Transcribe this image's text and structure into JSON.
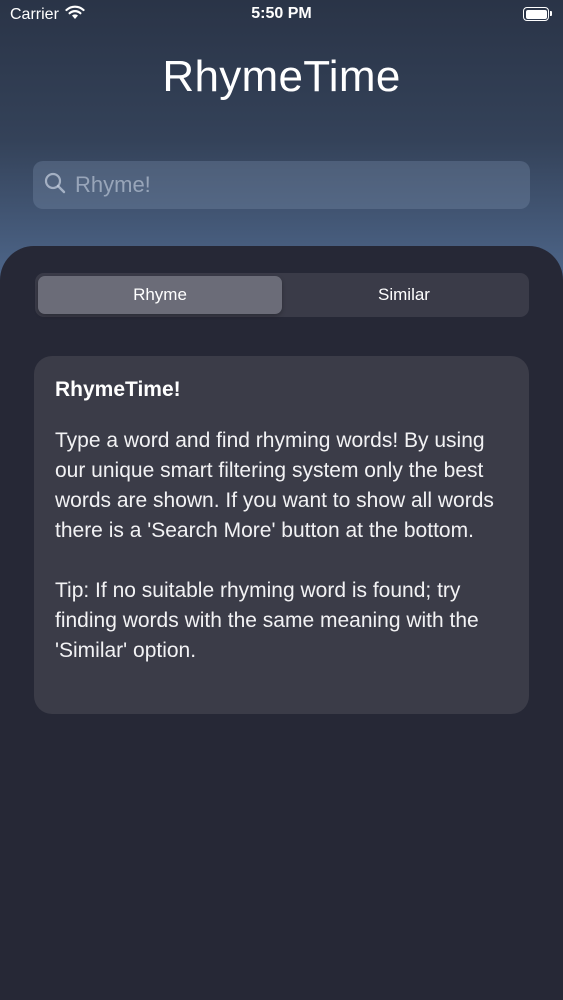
{
  "status_bar": {
    "carrier": "Carrier",
    "time": "5:50 PM"
  },
  "app": {
    "title": "RhymeTime"
  },
  "search": {
    "placeholder": "Rhyme!",
    "value": ""
  },
  "segmented_control": {
    "options": [
      "Rhyme",
      "Similar"
    ],
    "selected": "Rhyme"
  },
  "info_card": {
    "title": "RhymeTime!",
    "body": "Type a word and find rhyming words! By using our unique  smart filtering system only the best words are shown. If you want to show all words there is a 'Search More' button at the bottom.",
    "tip": "Tip: If no suitable rhyming word is found; try finding words with the same meaning with the 'Similar' option."
  },
  "icons": {
    "search": "magnifying-glass",
    "wifi": "wifi-signal",
    "battery": "battery-full"
  }
}
